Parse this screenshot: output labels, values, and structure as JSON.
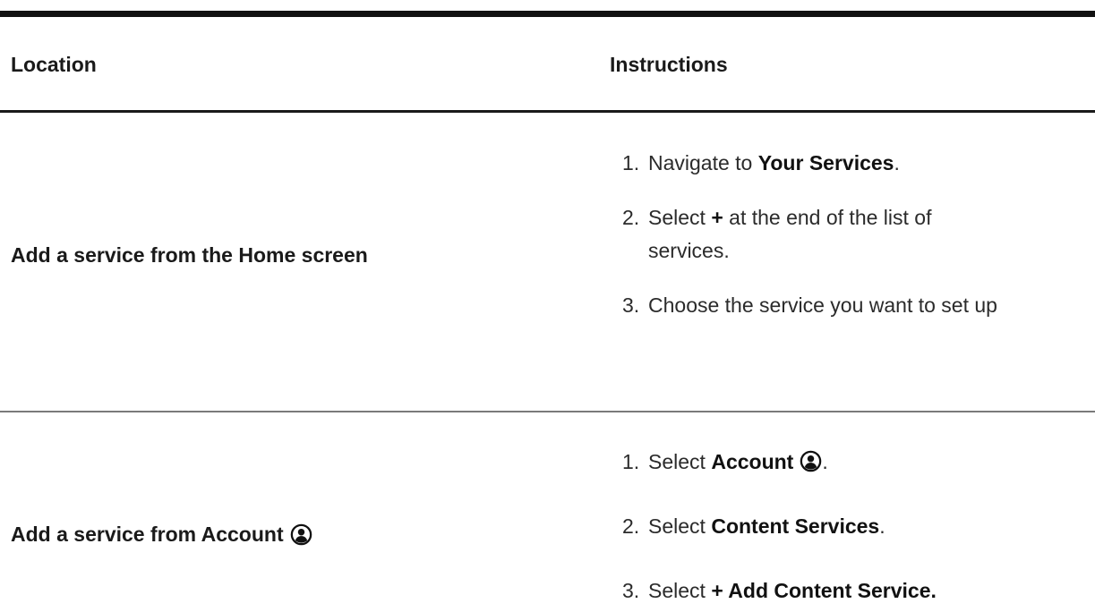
{
  "table": {
    "headers": {
      "location": "Location",
      "instructions": "Instructions"
    },
    "rows": [
      {
        "location": "Add a service from the Home screen",
        "steps": [
          {
            "number": "1.",
            "pre": "Navigate to ",
            "bold": "Your Services",
            "post": "."
          },
          {
            "number": "2.",
            "pre": "Select ",
            "bold": "+",
            "post": " at the end of the list of",
            "line2": "services."
          },
          {
            "number": "3.",
            "pre": "Choose the service you want to set up"
          }
        ]
      },
      {
        "location": "Add a service from Account",
        "location_icon": "account-icon",
        "steps": [
          {
            "number": "1.",
            "pre": "Select ",
            "bold": "Account",
            "icon": "account-icon",
            "post": "."
          },
          {
            "number": "2.",
            "pre": "Select ",
            "bold": "Content Services",
            "post": "."
          },
          {
            "number": "3.",
            "pre": "Select ",
            "bold": "+ Add Content Service."
          }
        ]
      }
    ]
  },
  "colors": {
    "rule": "#111111",
    "divider": "#7a7a7a",
    "text": "#2b2b2b"
  }
}
